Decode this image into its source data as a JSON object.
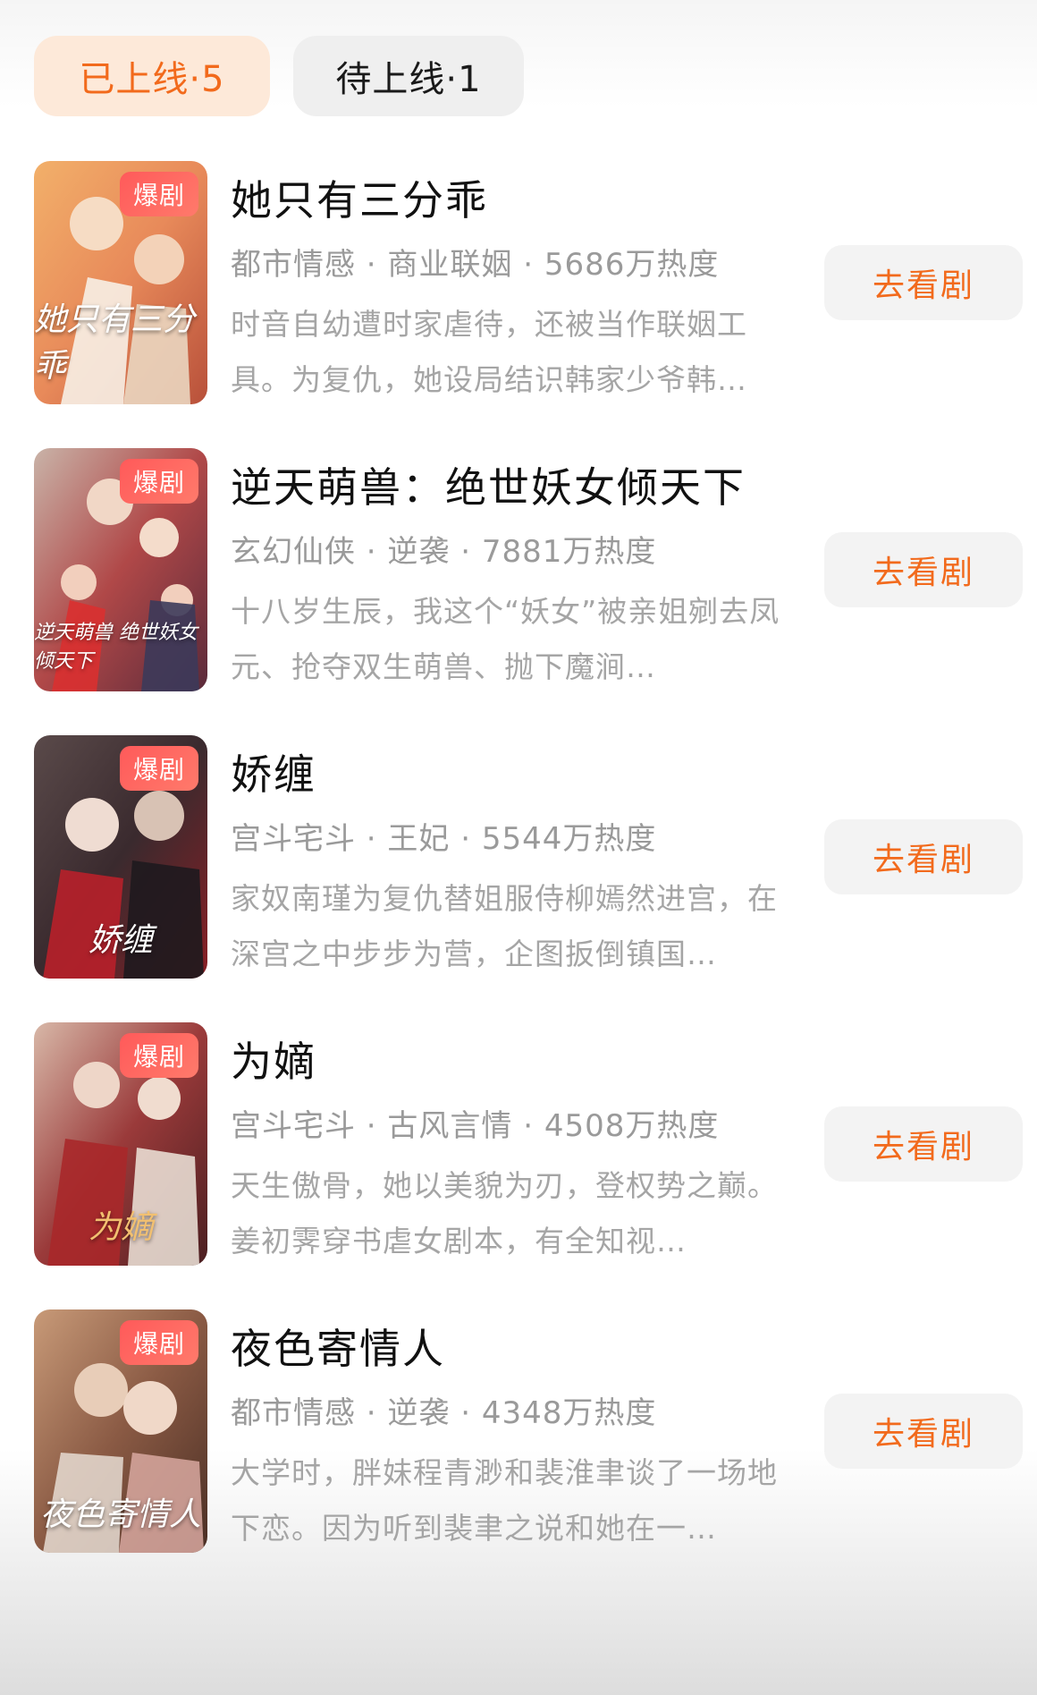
{
  "tabs": [
    {
      "label": "已上线·5",
      "active": true
    },
    {
      "label": "待上线·1",
      "active": false
    }
  ],
  "colors": {
    "accent": "#f26a1c",
    "tab_active_bg": "#fde9d9",
    "badge": "#ff5a5a"
  },
  "dramas": [
    {
      "title": "她只有三分乖",
      "meta": "都市情感 · 商业联姻 · 5686万热度",
      "desc": "时音自幼遭时家虐待，还被当作联姻工具。为复仇，她设局结识韩家少爷韩…",
      "badge": "爆剧",
      "poster_text": "她只有三分乖",
      "button": "去看剧"
    },
    {
      "title": "逆天萌兽：绝世妖女倾天下",
      "meta": "玄幻仙侠 · 逆袭 · 7881万热度",
      "desc": "十八岁生辰，我这个“妖女”被亲姐剜去凤元、抢夺双生萌兽、抛下魔涧…",
      "badge": "爆剧",
      "poster_text": "逆天萌兽 绝世妖女倾天下",
      "button": "去看剧"
    },
    {
      "title": "娇缠",
      "meta": "宫斗宅斗 · 王妃 · 5544万热度",
      "desc": "家奴南瑾为复仇替姐服侍柳嫣然进宫，在深宫之中步步为营，企图扳倒镇国…",
      "badge": "爆剧",
      "poster_text": "娇缠",
      "button": "去看剧"
    },
    {
      "title": "为嫡",
      "meta": "宫斗宅斗 · 古风言情 · 4508万热度",
      "desc": "天生傲骨，她以美貌为刃，登权势之巅。姜初霁穿书虐女剧本，有全知视…",
      "badge": "爆剧",
      "poster_text": "为嫡",
      "button": "去看剧"
    },
    {
      "title": "夜色寄情人",
      "meta": "都市情感 · 逆袭 · 4348万热度",
      "desc": "大学时，胖妹程青渺和裴淮聿谈了一场地下恋。因为听到裴聿之说和她在一…",
      "badge": "爆剧",
      "poster_text": "夜色寄情人",
      "button": "去看剧"
    }
  ]
}
